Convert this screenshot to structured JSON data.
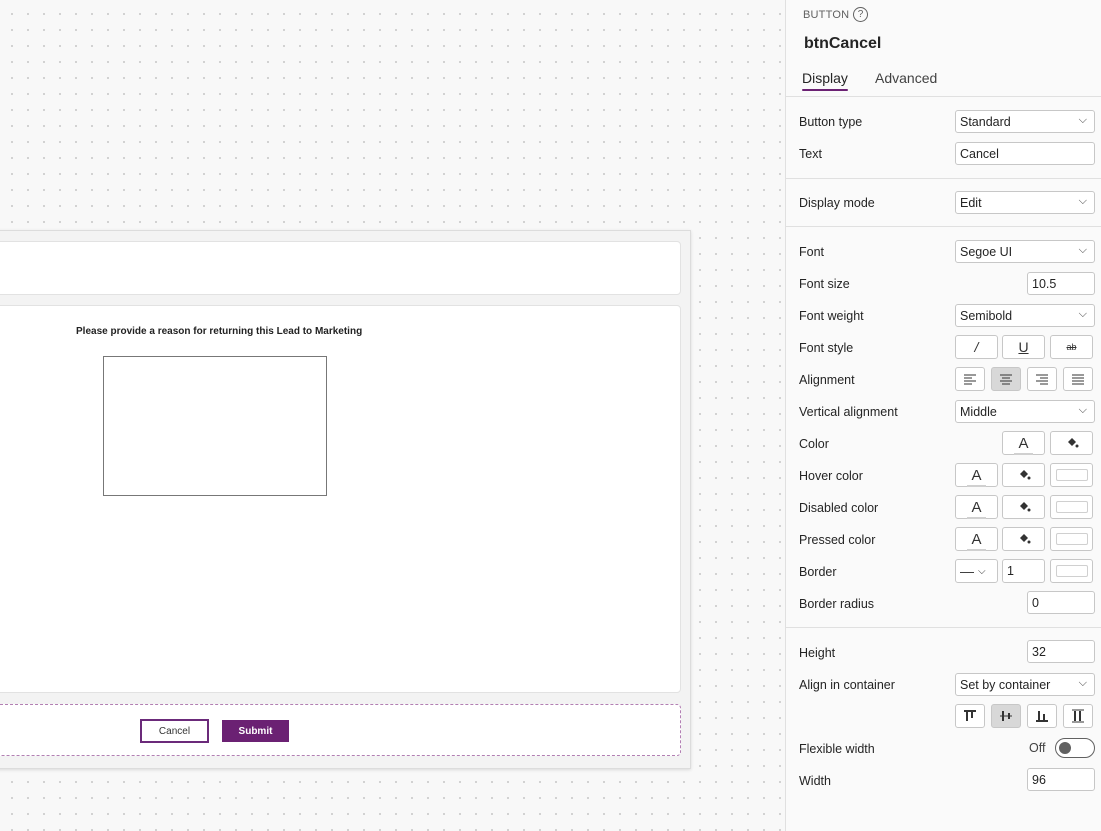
{
  "canvas": {
    "prompt": "Please provide a reason for returning this Lead to Marketing",
    "cancel_label": "Cancel",
    "submit_label": "Submit"
  },
  "panel": {
    "control_type": "BUTTON",
    "control_name": "btnCancel",
    "tabs": [
      "Display",
      "Advanced"
    ],
    "labels": {
      "button_type": "Button type",
      "text": "Text",
      "display_mode": "Display mode",
      "font": "Font",
      "font_size": "Font size",
      "font_weight": "Font weight",
      "font_style": "Font style",
      "alignment": "Alignment",
      "vertical_alignment": "Vertical alignment",
      "color": "Color",
      "hover_color": "Hover color",
      "disabled_color": "Disabled color",
      "pressed_color": "Pressed color",
      "border": "Border",
      "border_radius": "Border radius",
      "height": "Height",
      "align_in_container": "Align in container",
      "flexible_width": "Flexible width",
      "width": "Width"
    },
    "values": {
      "button_type": "Standard",
      "text": "Cancel",
      "display_mode": "Edit",
      "font": "Segoe UI",
      "font_size": "10.5",
      "font_weight": "Semibold",
      "vertical_alignment": "Middle",
      "border_thickness": "1",
      "border_radius": "0",
      "height": "32",
      "align_in_container": "Set by container",
      "flexible_width": "Off",
      "width": "96"
    },
    "icons": {
      "italic": "/",
      "underline": "U",
      "strikethrough": "ab",
      "text_color": "A",
      "fill": "paint-bucket",
      "border_style": "—"
    },
    "accent_color": "#6b2173"
  }
}
